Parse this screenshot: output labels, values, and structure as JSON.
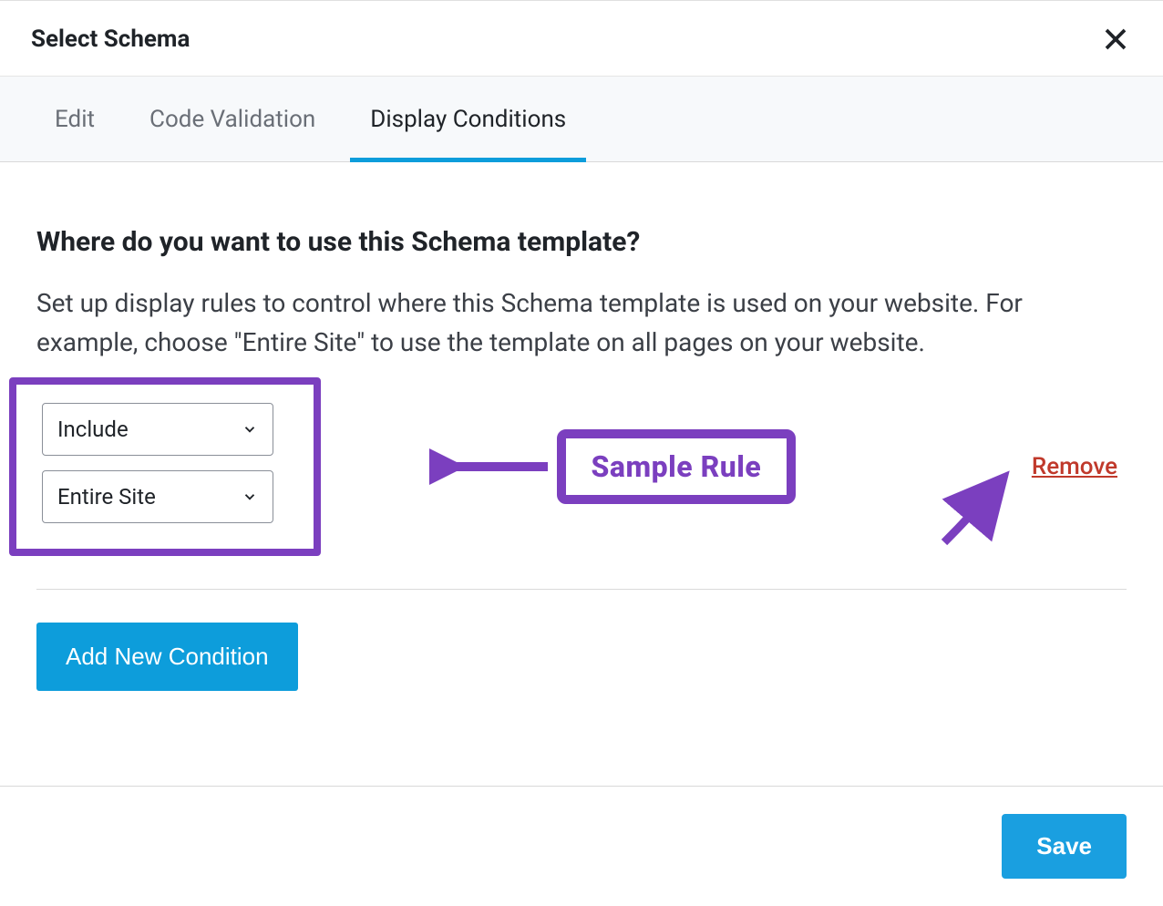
{
  "header": {
    "title": "Select Schema"
  },
  "tabs": {
    "items": [
      "Edit",
      "Code Validation",
      "Display Conditions"
    ],
    "active_index": 2
  },
  "content": {
    "heading": "Where do you want to use this Schema template?",
    "description": "Set up display rules to control where this Schema template is used on your website. For example, choose \"Entire Site\" to use the template on all pages on your website."
  },
  "rule": {
    "condition_type": "Include",
    "scope": "Entire Site",
    "remove_label": "Remove"
  },
  "annotation": {
    "callout_label": "Sample Rule"
  },
  "buttons": {
    "add_condition": "Add New Condition",
    "save": "Save"
  },
  "colors": {
    "accent": "#0d9ddb",
    "annotation": "#7b3fbf",
    "danger": "#c0392b"
  }
}
